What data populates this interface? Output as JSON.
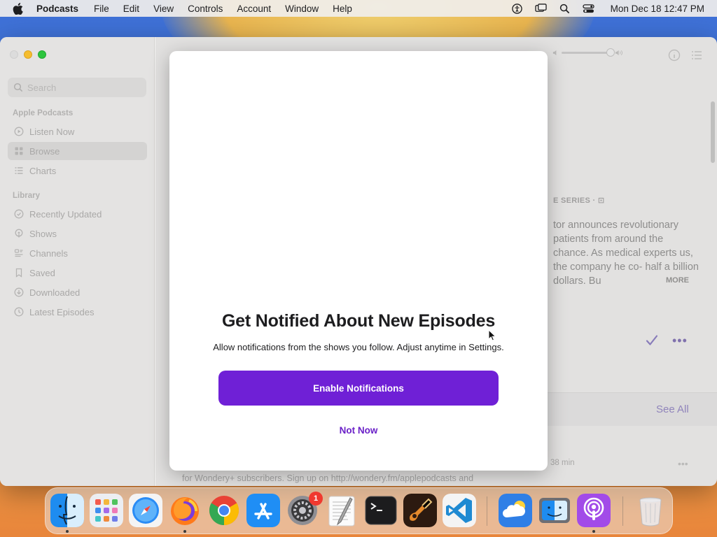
{
  "menubar": {
    "app_name": "Podcasts",
    "items": [
      "File",
      "Edit",
      "View",
      "Controls",
      "Account",
      "Window",
      "Help"
    ],
    "clock": "Mon Dec 18  12:47 PM"
  },
  "sidebar": {
    "search_placeholder": "Search",
    "section_apple": "Apple Podcasts",
    "apple_items": [
      {
        "label": "Listen Now",
        "icon": "play-circle-icon"
      },
      {
        "label": "Browse",
        "icon": "grid-icon",
        "selected": true
      },
      {
        "label": "Charts",
        "icon": "list-icon"
      }
    ],
    "section_library": "Library",
    "library_items": [
      {
        "label": "Recently Updated",
        "icon": "clock-check-icon"
      },
      {
        "label": "Shows",
        "icon": "podcast-icon"
      },
      {
        "label": "Channels",
        "icon": "channels-icon"
      },
      {
        "label": "Saved",
        "icon": "bookmark-icon"
      },
      {
        "label": "Downloaded",
        "icon": "download-icon"
      },
      {
        "label": "Latest Episodes",
        "icon": "latest-icon"
      }
    ]
  },
  "content": {
    "series_label": "E SERIES · ⊡",
    "description": "tor announces revolutionary patients from around the chance. As medical experts us, the company he co- half a billion dollars. Bu",
    "more_label": "MORE",
    "see_all": "See All",
    "duration": "38 min",
    "bottom_text": "for Wondery+ subscribers. Sign up on http://wondery.fm/applepodcasts and"
  },
  "modal": {
    "heading": "Get Notified About New Episodes",
    "subtext": "Allow notifications from the shows you follow. Adjust anytime in Settings.",
    "enable_label": "Enable Notifications",
    "notnow_label": "Not Now"
  },
  "dock": {
    "apps": [
      "Finder",
      "Launchpad",
      "Safari",
      "Firefox",
      "Chrome",
      "App Store",
      "System Settings",
      "TextEdit",
      "Terminal",
      "GarageBand",
      "Visual Studio Code",
      "Weather",
      "Migration Assistant",
      "Podcasts",
      "Trash"
    ],
    "settings_badge": "1"
  },
  "colors": {
    "accent_purple": "#6f20d6",
    "not_now_purple": "#6b21c8",
    "window_bg": "#f3f2f1",
    "sidebar_bg": "#e4e3e2"
  }
}
